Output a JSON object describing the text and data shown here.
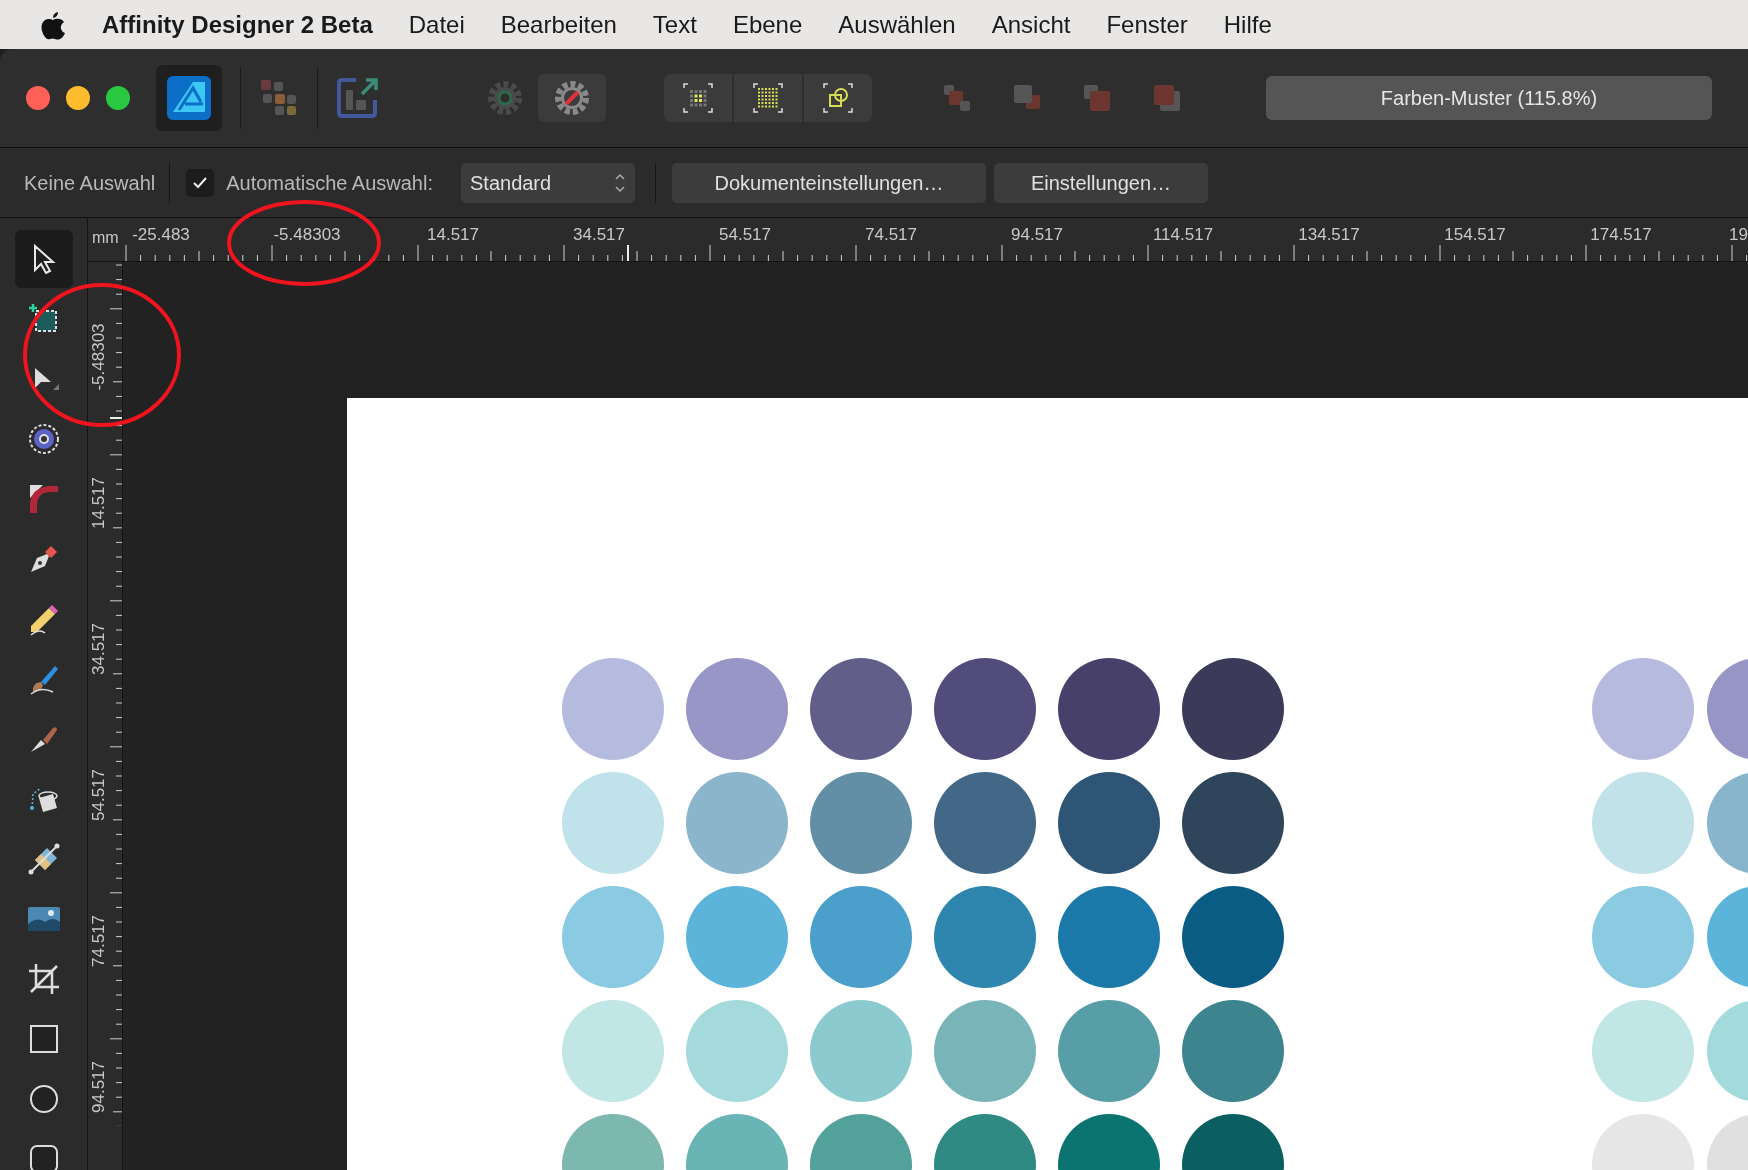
{
  "menu_bar": {
    "app_name": "Affinity Designer 2 Beta",
    "items": [
      "Datei",
      "Bearbeiten",
      "Text",
      "Ebene",
      "Auswählen",
      "Ansicht",
      "Fenster",
      "Hilfe"
    ]
  },
  "toolbar": {
    "document_title": "Farben-Muster (115.8%)"
  },
  "context_bar": {
    "selection_label": "Keine Auswahl",
    "auto_select": {
      "label": "Automatische Auswahl:",
      "checked": true
    },
    "mode_dropdown": {
      "value": "Standard"
    },
    "buttons": [
      "Dokumenteinstellungen…",
      "Einstellungen…"
    ]
  },
  "rulers": {
    "unit": "mm",
    "horizontal_labels": [
      "-25.483",
      "-5.48303",
      "14.517",
      "34.517",
      "54.517",
      "74.517",
      "94.517",
      "114.517",
      "134.517",
      "154.517",
      "174.517",
      "19"
    ],
    "vertical_labels": [
      "-5.48303",
      "14.517",
      "34.517",
      "54.517",
      "74.517",
      "94.517"
    ]
  },
  "tools": [
    {
      "kind": "move",
      "selected": true
    },
    {
      "kind": "artboard",
      "selected": false
    },
    {
      "kind": "node",
      "selected": false
    },
    {
      "kind": "contour",
      "selected": false
    },
    {
      "kind": "corner",
      "selected": false
    },
    {
      "kind": "pen",
      "selected": false
    },
    {
      "kind": "pencil",
      "selected": false
    },
    {
      "kind": "brush",
      "selected": false
    },
    {
      "kind": "knife",
      "selected": false
    },
    {
      "kind": "fill",
      "selected": false
    },
    {
      "kind": "transparency",
      "selected": false
    },
    {
      "kind": "image",
      "selected": false
    },
    {
      "kind": "crop",
      "selected": false
    },
    {
      "kind": "rectangle",
      "selected": false
    },
    {
      "kind": "ellipse",
      "selected": false
    },
    {
      "kind": "rounded_rectangle",
      "selected": false
    }
  ],
  "swatch_groups": [
    {
      "rows": [
        {
          "swatches": [
            {
              "color": "#b5badf"
            },
            {
              "color": "#9896c7"
            },
            {
              "color": "#625e8a"
            },
            {
              "color": "#514c7c"
            },
            {
              "color": "#46406a"
            },
            {
              "color": "#3b3a58"
            }
          ]
        },
        {
          "swatches": [
            {
              "color": "#c0e2ea"
            },
            {
              "color": "#8ab5cb"
            },
            {
              "color": "#628fa6"
            },
            {
              "color": "#436887"
            },
            {
              "color": "#2e5575"
            },
            {
              "color": "#2e455b"
            }
          ]
        },
        {
          "swatches": [
            {
              "color": "#8acbe3"
            },
            {
              "color": "#5cb4da"
            },
            {
              "color": "#4a9fcb"
            },
            {
              "color": "#2e86ae"
            },
            {
              "color": "#1b79aa"
            },
            {
              "color": "#0a5c85"
            }
          ]
        },
        {
          "swatches": [
            {
              "color": "#c0e6e5"
            },
            {
              "color": "#a4dadc"
            },
            {
              "color": "#8bcacf"
            },
            {
              "color": "#79b4b9"
            },
            {
              "color": "#589ea6"
            },
            {
              "color": "#3d848f"
            }
          ]
        },
        {
          "swatches": [
            {
              "color": "#7cb8af"
            },
            {
              "color": "#69b5b5"
            },
            {
              "color": "#52a19a"
            },
            {
              "color": "#2e8a83"
            },
            {
              "color": "#0c7470"
            },
            {
              "color": "#0c5f60"
            }
          ]
        }
      ]
    },
    {
      "rows": [
        {
          "swatches": [
            {
              "color": "#b6bade"
            },
            {
              "color": "#9794c6"
            }
          ]
        },
        {
          "swatches": [
            {
              "color": "#c2e2ea"
            },
            {
              "color": "#88b5cb"
            }
          ]
        },
        {
          "swatches": [
            {
              "color": "#8acbe2"
            },
            {
              "color": "#5bb4da"
            }
          ]
        },
        {
          "swatches": [
            {
              "color": "#c0e6e5"
            },
            {
              "color": "#a3dbdc"
            }
          ]
        },
        {
          "swatches": [
            {
              "color": "#e6e6e6"
            },
            {
              "color": "#e0e0e0"
            }
          ]
        }
      ]
    }
  ]
}
